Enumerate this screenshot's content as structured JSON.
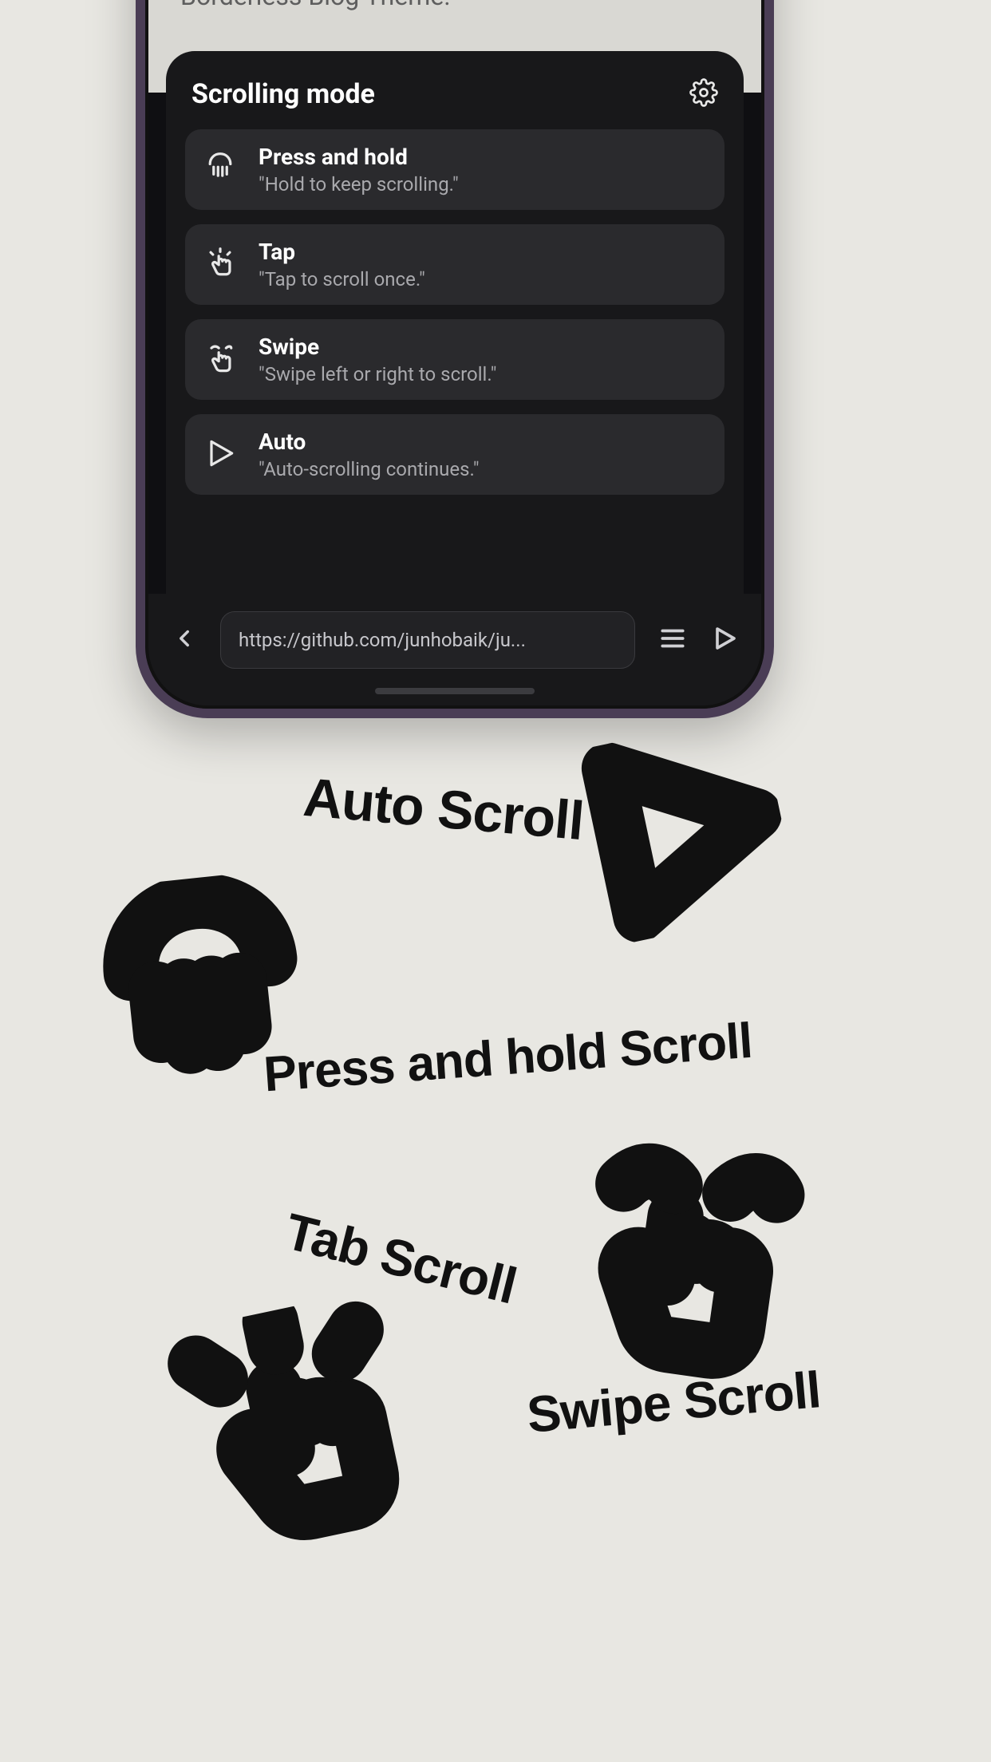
{
  "page_bg": {
    "text_fragment": "Borderless Blog Theme."
  },
  "sheet": {
    "title": "Scrolling mode",
    "options": [
      {
        "title": "Press and hold",
        "desc": "\"Hold to keep scrolling.\""
      },
      {
        "title": "Tap",
        "desc": "\"Tap to scroll once.\""
      },
      {
        "title": "Swipe",
        "desc": "\"Swipe left or right to scroll.\""
      },
      {
        "title": "Auto",
        "desc": "\"Auto-scrolling continues.\""
      }
    ]
  },
  "bottom_bar": {
    "url": "https://github.com/junhobaik/ju..."
  },
  "annotations": {
    "auto": "Auto Scroll",
    "press": "Press and hold Scroll",
    "tab": "Tab Scroll",
    "swipe": "Swipe Scroll"
  }
}
